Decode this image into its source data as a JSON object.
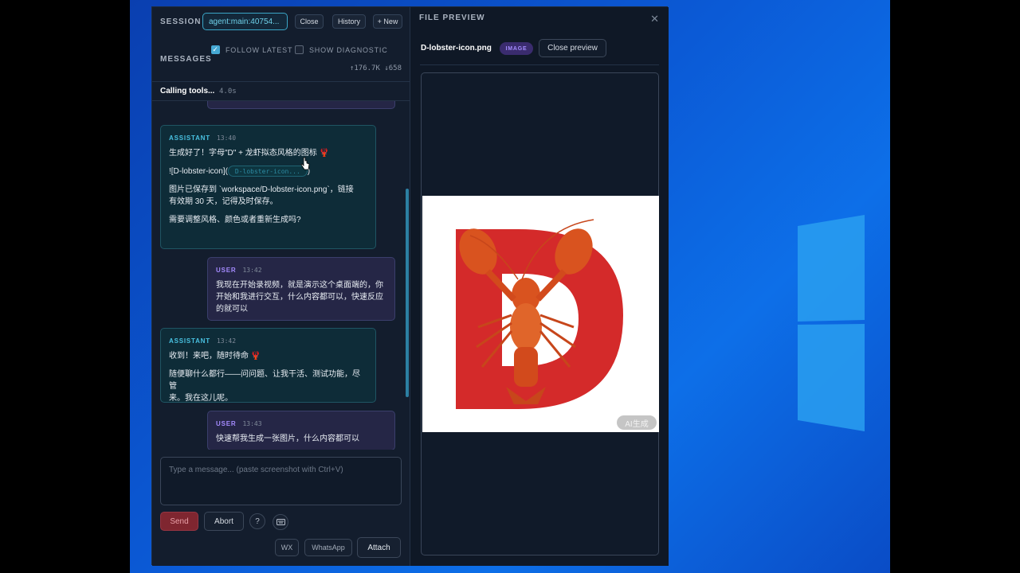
{
  "session": {
    "label": "SESSION",
    "agent_id": "agent:main:40754...",
    "close_label": "Close",
    "history_label": "History",
    "new_label": "+ New"
  },
  "messages_header": {
    "label": "MESSAGES",
    "follow_latest": {
      "label": "FOLLOW LATEST",
      "checked": true
    },
    "show_diagnostic": {
      "label": "SHOW DIAGNOSTIC",
      "checked": false
    },
    "tokens": "↑176.7K ↓658"
  },
  "status": {
    "text": "Calling tools...",
    "elapsed": "4.0s"
  },
  "chat": {
    "messages": [
      {
        "role": "ASSISTANT",
        "time": "13:40",
        "line1": "生成好了！字母\"D\" + 龙虾拟态风格的图标 🦞",
        "image_md_prefix": "![D-lobster-icon](",
        "image_md_chip": "D-lobster-icon...",
        "image_md_suffix": ")",
        "line3a": "图片已保存到 `workspace/D-lobster-icon.png`，链接",
        "line3b": "有效期 30 天，记得及时保存。",
        "line4": "需要调整风格、颜色或者重新生成吗?"
      },
      {
        "role": "USER",
        "time": "13:42",
        "line1": "我现在开始录视频，就是演示这个桌面端的，你",
        "line2": "开始和我进行交互，什么内容都可以，快速反应",
        "line3": "的就可以"
      },
      {
        "role": "ASSISTANT",
        "time": "13:42",
        "line1": "收到！来吧，随时待命 🦞",
        "line2a": "随便聊什么都行——问问题、让我干活、测试功能，尽管",
        "line2b": "来。我在这儿呢。"
      },
      {
        "role": "USER",
        "time": "13:43",
        "line1": "快速帮我生成一张图片，什么内容都可以"
      }
    ]
  },
  "composer": {
    "placeholder": "Type a message... (paste screenshot with Ctrl+V)",
    "send_label": "Send",
    "abort_label": "Abort",
    "help_label": "?",
    "wx_label": "WX",
    "whatsapp_label": "WhatsApp",
    "attach_label": "Attach"
  },
  "file_preview": {
    "title": "FILE PREVIEW",
    "filename": "D-lobster-icon.png",
    "type_badge": "IMAGE",
    "close_preview_label": "Close preview",
    "ai_tag": "AI生成"
  },
  "colors": {
    "accent": "#49c2e2",
    "user_accent": "#a58bff",
    "send": "#7f2630",
    "lobster": "#d9531f",
    "letter_d": "#d42a2a"
  }
}
